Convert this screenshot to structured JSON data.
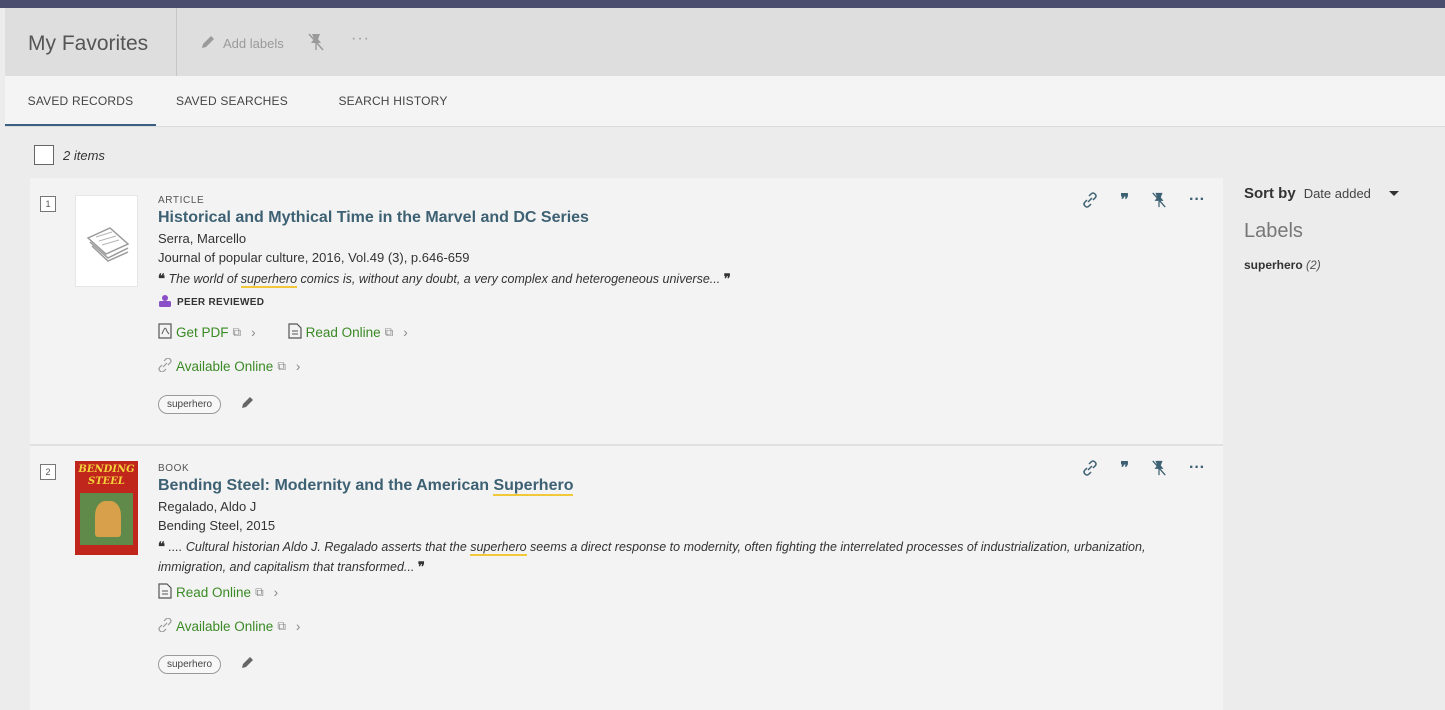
{
  "header": {
    "title": "My Favorites",
    "add_labels": "Add labels",
    "more": "···"
  },
  "tabs": [
    {
      "label": "SAVED RECORDS",
      "active": true
    },
    {
      "label": "SAVED SEARCHES",
      "active": false
    },
    {
      "label": "SEARCH HISTORY",
      "active": false
    }
  ],
  "count_text": "2 items",
  "records": [
    {
      "index": "1",
      "type": "ARTICLE",
      "title": "Historical and Mythical Time in the Marvel and DC Series",
      "author": "Serra, Marcello",
      "source": "Journal of popular culture, 2016, Vol.49 (3), p.646-659",
      "snippet_pre": "The world of ",
      "snippet_hl": "superhero",
      "snippet_post": " comics is, without any doubt, a very complex and heterogeneous universe...",
      "peer_reviewed": "PEER REVIEWED",
      "links": [
        "Get PDF",
        "Read Online"
      ],
      "available": "Available Online",
      "label_chip": "superhero"
    },
    {
      "index": "2",
      "type": "BOOK",
      "title_pre": "Bending Steel: Modernity and the American ",
      "title_hl": "Superhero",
      "author": "Regalado, Aldo J",
      "source": "Bending Steel, 2015",
      "snippet_pre": ".... Cultural historian Aldo J. Regalado asserts that the ",
      "snippet_hl": "superhero",
      "snippet_post": " seems a direct response to modernity, often fighting the interrelated processes of industrialization, urbanization, immigration, and capitalism that transformed...",
      "cover_text": "BENDING STEEL",
      "links": [
        "Read Online"
      ],
      "available": "Available Online",
      "label_chip": "superhero"
    }
  ],
  "sidebar": {
    "sort_label": "Sort by",
    "sort_value": "Date added",
    "labels_heading": "Labels",
    "label_name": "superhero",
    "label_count": "(2)"
  },
  "colors": {
    "link_green": "#3a8a25",
    "title_blue": "#3d6173",
    "highlight": "#f2c83b",
    "top_bar": "#4a4d6e"
  }
}
